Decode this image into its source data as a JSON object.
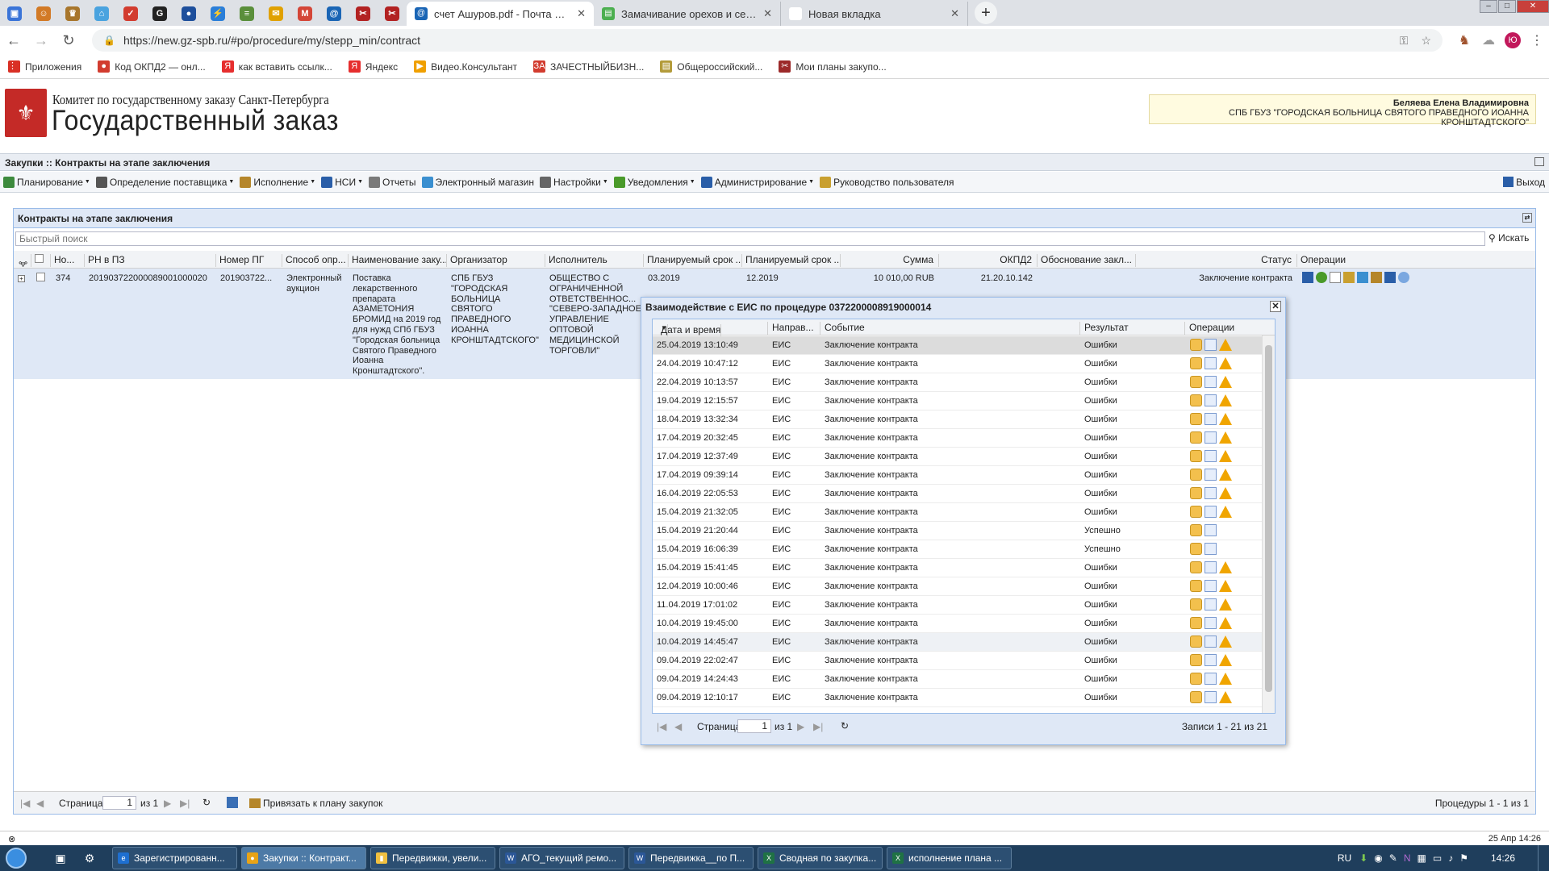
{
  "browser": {
    "pinned": [
      {
        "g": "▣",
        "c": "#3a74d8"
      },
      {
        "g": "☺",
        "c": "#d27a26"
      },
      {
        "g": "♛",
        "c": "#a8762c"
      },
      {
        "g": "⌂",
        "c": "#4aa3df"
      },
      {
        "g": "✓",
        "c": "#d23c2f"
      },
      {
        "g": "G",
        "c": "#222222"
      },
      {
        "g": "●",
        "c": "#1e4f9c"
      },
      {
        "g": "⚡",
        "c": "#2a7ed8"
      },
      {
        "g": "≡",
        "c": "#5a8f3b"
      },
      {
        "g": "✉",
        "c": "#e0a100"
      },
      {
        "g": "M",
        "c": "#d44638"
      },
      {
        "g": "@",
        "c": "#1a65b5"
      },
      {
        "g": "✂",
        "c": "#b22222"
      },
      {
        "g": "✂",
        "c": "#b22222"
      }
    ],
    "tabs": [
      {
        "title": "счет Ашуров.pdf - Почта Mail.Ru",
        "fav": "@",
        "color": "#1a65b5",
        "active": true
      },
      {
        "title": "Замачивание орехов и семечек",
        "fav": "▤",
        "color": "#4caf50",
        "active": false
      },
      {
        "title": "Новая вкладка",
        "fav": "",
        "color": "#ffffff",
        "active": false
      }
    ],
    "url": "https://new.gz-spb.ru/#po/procedure/my/stepp_min/contract",
    "profile_initial": "Ю",
    "bookmarks": [
      {
        "label": "Приложения",
        "g": "⋮⋮",
        "c": "#d93025"
      },
      {
        "label": "Код ОКПД2 — онл...",
        "g": "●",
        "c": "#d23c2f"
      },
      {
        "label": "как вставить ссылк...",
        "g": "Я",
        "c": "#e62e2e"
      },
      {
        "label": "Яндекс",
        "g": "Я",
        "c": "#e62e2e"
      },
      {
        "label": "Видео.Консультант",
        "g": "▶",
        "c": "#f0a000"
      },
      {
        "label": "ЗАЧЕСТНЫЙБИЗН...",
        "g": "ЗА",
        "c": "#d23c2f"
      },
      {
        "label": "Общероссийский...",
        "g": "▤",
        "c": "#b39b3a"
      },
      {
        "label": "Мои планы закупо...",
        "g": "✂",
        "c": "#9c2a2a"
      }
    ]
  },
  "header": {
    "line1": "Комитет по государственному заказу Санкт-Петербурга",
    "line2": "Государственный заказ",
    "user_name": "Беляева Елена Владимировна",
    "user_org": "СПБ ГБУЗ \"ГОРОДСКАЯ БОЛЬНИЦА СВЯТОГО ПРАВЕДНОГО ИОАННА КРОНШТАДТСКОГО\""
  },
  "breadcrumb": "Закупки :: Контракты на этапе заключения",
  "menu": [
    {
      "label": "Планирование",
      "dd": true,
      "c": "#3d8a3d"
    },
    {
      "label": "Определение поставщика",
      "dd": true,
      "c": "#555555"
    },
    {
      "label": "Исполнение",
      "dd": true,
      "c": "#b5862a"
    },
    {
      "label": "НСИ",
      "dd": true,
      "c": "#2a5ea8"
    },
    {
      "label": "Отчеты",
      "dd": false,
      "c": "#7a7a7a"
    },
    {
      "label": "Электронный магазин",
      "dd": false,
      "c": "#3a8fd0"
    },
    {
      "label": "Настройки",
      "dd": true,
      "c": "#666666"
    },
    {
      "label": "Уведомления",
      "dd": true,
      "c": "#4a9a2a"
    },
    {
      "label": "Администрирование",
      "dd": true,
      "c": "#2a5ea8"
    },
    {
      "label": "Руководство пользователя",
      "dd": false,
      "c": "#c9a030"
    }
  ],
  "exit_label": "Выход",
  "panel": {
    "title": "Контракты на этапе заключения",
    "search_placeholder": "Быстрый поиск",
    "search_button": "Искать",
    "columns": [
      "Но...",
      "РН в ПЗ",
      "Номер ПГ",
      "Способ опр...",
      "Наименование заку...",
      "Организатор",
      "Исполнитель",
      "Планируемый срок ...",
      "Планируемый срок ...",
      "Сумма",
      "ОКПД2",
      "Обоснование закл...",
      "Статус",
      "Операции"
    ],
    "row": {
      "num": "374",
      "rn": "20190372200008900100002​0",
      "pg": "201903722...",
      "method": "Электронный аукцион",
      "name": "Поставка лекарственного препарата АЗАМЕТОНИЯ БРОМИД на 2019 год для нужд СПб ГБУЗ \"Городская больница Святого Праведного Иоанна Кронштадтского\".",
      "organizer": "СПБ ГБУЗ \"ГОРОДСКАЯ БОЛЬНИЦА СВЯТОГО ПРАВЕДНОГО ИОАННА КРОНШТАДТСКОГО\"",
      "executor": "ОБЩЕСТВО С ОГРАНИЧЕННОЙ ОТВЕТСТВЕННОС... \"СЕВЕРО-ЗАПАДНОЕ УПРАВЛЕНИЕ ОПТОВОЙ МЕДИЦИНСКОЙ ТОРГОВЛИ\"",
      "plan1": "03.2019",
      "plan2": "12.2019",
      "sum": "10 010,00 RUB",
      "okpd": "21.20.10.142",
      "status": "Заключение контракта"
    },
    "footer": {
      "page_label": "Страница",
      "page": "1",
      "of": "из 1",
      "bind_label": "Привязать к плану закупок",
      "records": "Процедуры 1 - 1 из 1"
    }
  },
  "modal": {
    "title": "Взаимодействие с ЕИС по процедуре 0372200008919000014",
    "columns": [
      "Дата и время",
      "Направ...",
      "Событие",
      "Результат",
      "Операции"
    ],
    "rows": [
      {
        "dt": "25.04.2019 13:10:49",
        "dir": "ЕИС",
        "event": "Заключение контракта",
        "result": "Ошибки",
        "warn": true
      },
      {
        "dt": "24.04.2019 10:47:12",
        "dir": "ЕИС",
        "event": "Заключение контракта",
        "result": "Ошибки",
        "warn": true
      },
      {
        "dt": "22.04.2019 10:13:57",
        "dir": "ЕИС",
        "event": "Заключение контракта",
        "result": "Ошибки",
        "warn": true
      },
      {
        "dt": "19.04.2019 12:15:57",
        "dir": "ЕИС",
        "event": "Заключение контракта",
        "result": "Ошибки",
        "warn": true
      },
      {
        "dt": "18.04.2019 13:32:34",
        "dir": "ЕИС",
        "event": "Заключение контракта",
        "result": "Ошибки",
        "warn": true
      },
      {
        "dt": "17.04.2019 20:32:45",
        "dir": "ЕИС",
        "event": "Заключение контракта",
        "result": "Ошибки",
        "warn": true
      },
      {
        "dt": "17.04.2019 12:37:49",
        "dir": "ЕИС",
        "event": "Заключение контракта",
        "result": "Ошибки",
        "warn": true
      },
      {
        "dt": "17.04.2019 09:39:14",
        "dir": "ЕИС",
        "event": "Заключение контракта",
        "result": "Ошибки",
        "warn": true
      },
      {
        "dt": "16.04.2019 22:05:53",
        "dir": "ЕИС",
        "event": "Заключение контракта",
        "result": "Ошибки",
        "warn": true
      },
      {
        "dt": "15.04.2019 21:32:05",
        "dir": "ЕИС",
        "event": "Заключение контракта",
        "result": "Ошибки",
        "warn": true
      },
      {
        "dt": "15.04.2019 21:20:44",
        "dir": "ЕИС",
        "event": "Заключение контракта",
        "result": "Успешно",
        "warn": false
      },
      {
        "dt": "15.04.2019 16:06:39",
        "dir": "ЕИС",
        "event": "Заключение контракта",
        "result": "Успешно",
        "warn": false
      },
      {
        "dt": "15.04.2019 15:41:45",
        "dir": "ЕИС",
        "event": "Заключение контракта",
        "result": "Ошибки",
        "warn": true
      },
      {
        "dt": "12.04.2019 10:00:46",
        "dir": "ЕИС",
        "event": "Заключение контракта",
        "result": "Ошибки",
        "warn": true
      },
      {
        "dt": "11.04.2019 17:01:02",
        "dir": "ЕИС",
        "event": "Заключение контракта",
        "result": "Ошибки",
        "warn": true
      },
      {
        "dt": "10.04.2019 19:45:00",
        "dir": "ЕИС",
        "event": "Заключение контракта",
        "result": "Ошибки",
        "warn": true
      },
      {
        "dt": "10.04.2019 14:45:47",
        "dir": "ЕИС",
        "event": "Заключение контракта",
        "result": "Ошибки",
        "warn": true
      },
      {
        "dt": "09.04.2019 22:02:47",
        "dir": "ЕИС",
        "event": "Заключение контракта",
        "result": "Ошибки",
        "warn": true
      },
      {
        "dt": "09.04.2019 14:24:43",
        "dir": "ЕИС",
        "event": "Заключение контракта",
        "result": "Ошибки",
        "warn": true
      },
      {
        "dt": "09.04.2019 12:10:17",
        "dir": "ЕИС",
        "event": "Заключение контракта",
        "result": "Ошибки",
        "warn": true
      }
    ],
    "footer": {
      "page_label": "Страница",
      "page": "1",
      "of": "из 1",
      "records": "Записи 1 - 21 из 21"
    }
  },
  "statusbar": {
    "left": "⊗",
    "date": "25 Апр 14:26"
  },
  "taskbar": {
    "items": [
      {
        "label": "Зарегистрированн...",
        "c": "#1e6fd0",
        "g": "e",
        "active": false
      },
      {
        "label": "Закупки :: Контракт...",
        "c": "#e8a317",
        "g": "●",
        "active": true
      },
      {
        "label": "Передвижки, увели...",
        "c": "#f0c040",
        "g": "▮",
        "active": false
      },
      {
        "label": "АГО_текущий ремо...",
        "c": "#2b5797",
        "g": "W",
        "active": false
      },
      {
        "label": "Передвижка__по П...",
        "c": "#2b5797",
        "g": "W",
        "active": false
      },
      {
        "label": "Сводная по закупка...",
        "c": "#1f7244",
        "g": "X",
        "active": false
      },
      {
        "label": "исполнение плана ...",
        "c": "#1f7244",
        "g": "X",
        "active": false
      }
    ],
    "lang": "RU",
    "time": "14:26"
  }
}
